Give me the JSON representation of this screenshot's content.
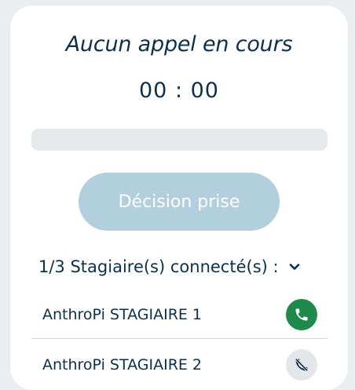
{
  "call": {
    "status": "Aucun appel en cours",
    "timer": "00 : 00",
    "progress_fraction": 0
  },
  "decision_button": {
    "label": "Décision prise",
    "enabled": false
  },
  "trainees": {
    "header": "1/3 Stagiaire(s) connecté(s) :",
    "items": [
      {
        "name": "AnthroPi STAGIAIRE 1",
        "call_icon": "phone-icon",
        "connected": true
      },
      {
        "name": "AnthroPi STAGIAIRE 2",
        "call_icon": "phone-off-icon",
        "connected": false
      }
    ]
  },
  "colors": {
    "text": "#0d2f4a",
    "accent_green": "#1f8a4c",
    "button_disabled": "#b2cfdd",
    "progress_track": "#e5e9ec",
    "background": "#ebeef1"
  }
}
